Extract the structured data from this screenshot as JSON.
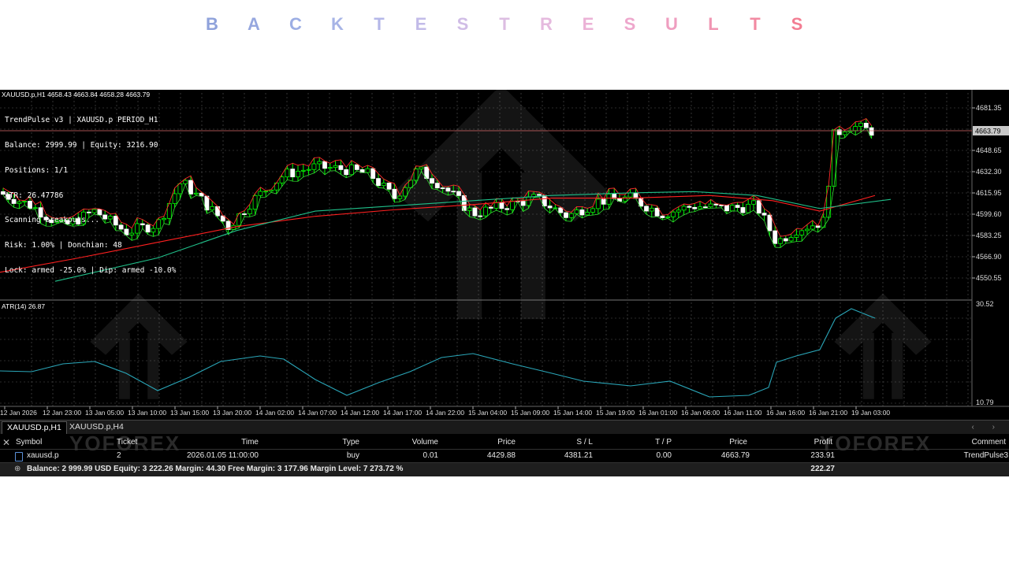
{
  "page_title_letters": [
    "B",
    "A",
    "C",
    "K",
    "T",
    "E",
    "S",
    "T",
    "R",
    "E",
    "S",
    "U",
    "L",
    "T",
    "S"
  ],
  "title_colors": [
    "#8fa2db",
    "#96a7df",
    "#9caee4",
    "#a7b4e6",
    "#b4b7e8",
    "#c2bbe8",
    "#d0bde6",
    "#dcbee2",
    "#e5bade",
    "#ebb2d6",
    "#eea7cc",
    "#ef9ec0",
    "#f095b2",
    "#f28aa2",
    "#f37d92"
  ],
  "chart": {
    "symbol_header": "XAUUSD.p,H1  4658.43 4663.84 4658.28 4663.79",
    "info_lines": [
      "TrendPulse v3 | XAUUSD.p PERIOD_H1",
      "Balance: 2999.99 | Equity: 3216.90",
      "Positions: 1/1",
      "ATR: 26.47786",
      "Scanning breakouts...",
      "Risk: 1.00% | Donchian: 48",
      "Lock: armed -25.0% | Dip: armed -10.0%"
    ],
    "price_labels": [
      "4681.35",
      "4648.65",
      "4632.30",
      "4615.95",
      "4599.60",
      "4583.25",
      "4566.90",
      "4550.55"
    ],
    "current_price": "4663.79",
    "atr_label": "ATR(14) 26.87",
    "atr_axis": [
      "30.52",
      "10.79"
    ],
    "time_labels": [
      "12 Jan 2026",
      "12 Jan 23:00",
      "13 Jan 05:00",
      "13 Jan 10:00",
      "13 Jan 15:00",
      "13 Jan 20:00",
      "14 Jan 02:00",
      "14 Jan 07:00",
      "14 Jan 12:00",
      "14 Jan 17:00",
      "14 Jan 22:00",
      "15 Jan 04:00",
      "15 Jan 09:00",
      "15 Jan 14:00",
      "15 Jan 19:00",
      "16 Jan 01:00",
      "16 Jan 06:00",
      "16 Jan 11:00",
      "16 Jan 16:00",
      "16 Jan 21:00",
      "19 Jan 03:00"
    ]
  },
  "tabs": [
    "XAUUSD.p,H1",
    "XAUUSD.p,H4"
  ],
  "tab_arrows": "‹ ›",
  "watermark": "YOFOREX",
  "trade_table": {
    "headers": {
      "symbol": "Symbol",
      "ticket": "Ticket",
      "time": "Time",
      "type": "Type",
      "volume": "Volume",
      "price": "Price",
      "sl": "S / L",
      "tp": "T / P",
      "price2": "Price",
      "profit": "Profit",
      "comment": "Comment"
    },
    "row": {
      "symbol": "xauusd.p",
      "ticket": "2",
      "time": "2026.01.05 11:00:00",
      "type": "buy",
      "volume": "0.01",
      "price": "4429.88",
      "sl": "4381.21",
      "tp": "0.00",
      "price2": "4663.79",
      "profit": "233.91",
      "comment": "TrendPulse3"
    },
    "summary": "Balance: 2 999.99 USD  Equity: 3 222.26  Margin: 44.30  Free Margin: 3 177.96  Margin Level: 7 273.72 %",
    "summary_profit": "222.27"
  }
}
